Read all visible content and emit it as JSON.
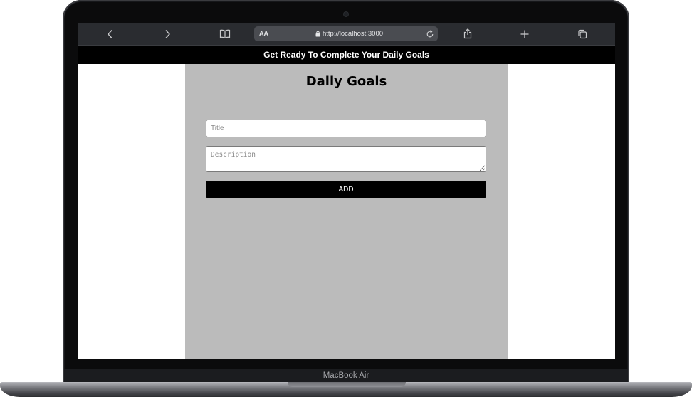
{
  "browser": {
    "url_text": "http://localhost:3000",
    "reader_label": "AA",
    "icons": [
      "chevron-left-icon",
      "chevron-right-icon",
      "book-icon",
      "lock-icon",
      "reload-icon",
      "share-icon",
      "plus-icon",
      "tabs-icon"
    ]
  },
  "page": {
    "header_text": "Get Ready To Complete Your Daily Goals",
    "title": "Daily Goals",
    "title_placeholder": "Title",
    "description_placeholder": "Description",
    "add_label": "ADD"
  },
  "device": {
    "brand": "MacBook Air"
  },
  "colors": {
    "header_bg": "#000000",
    "panel_bg": "#bbbbbb",
    "button_bg": "#000000",
    "toolbar_bg": "#2a2c30"
  }
}
